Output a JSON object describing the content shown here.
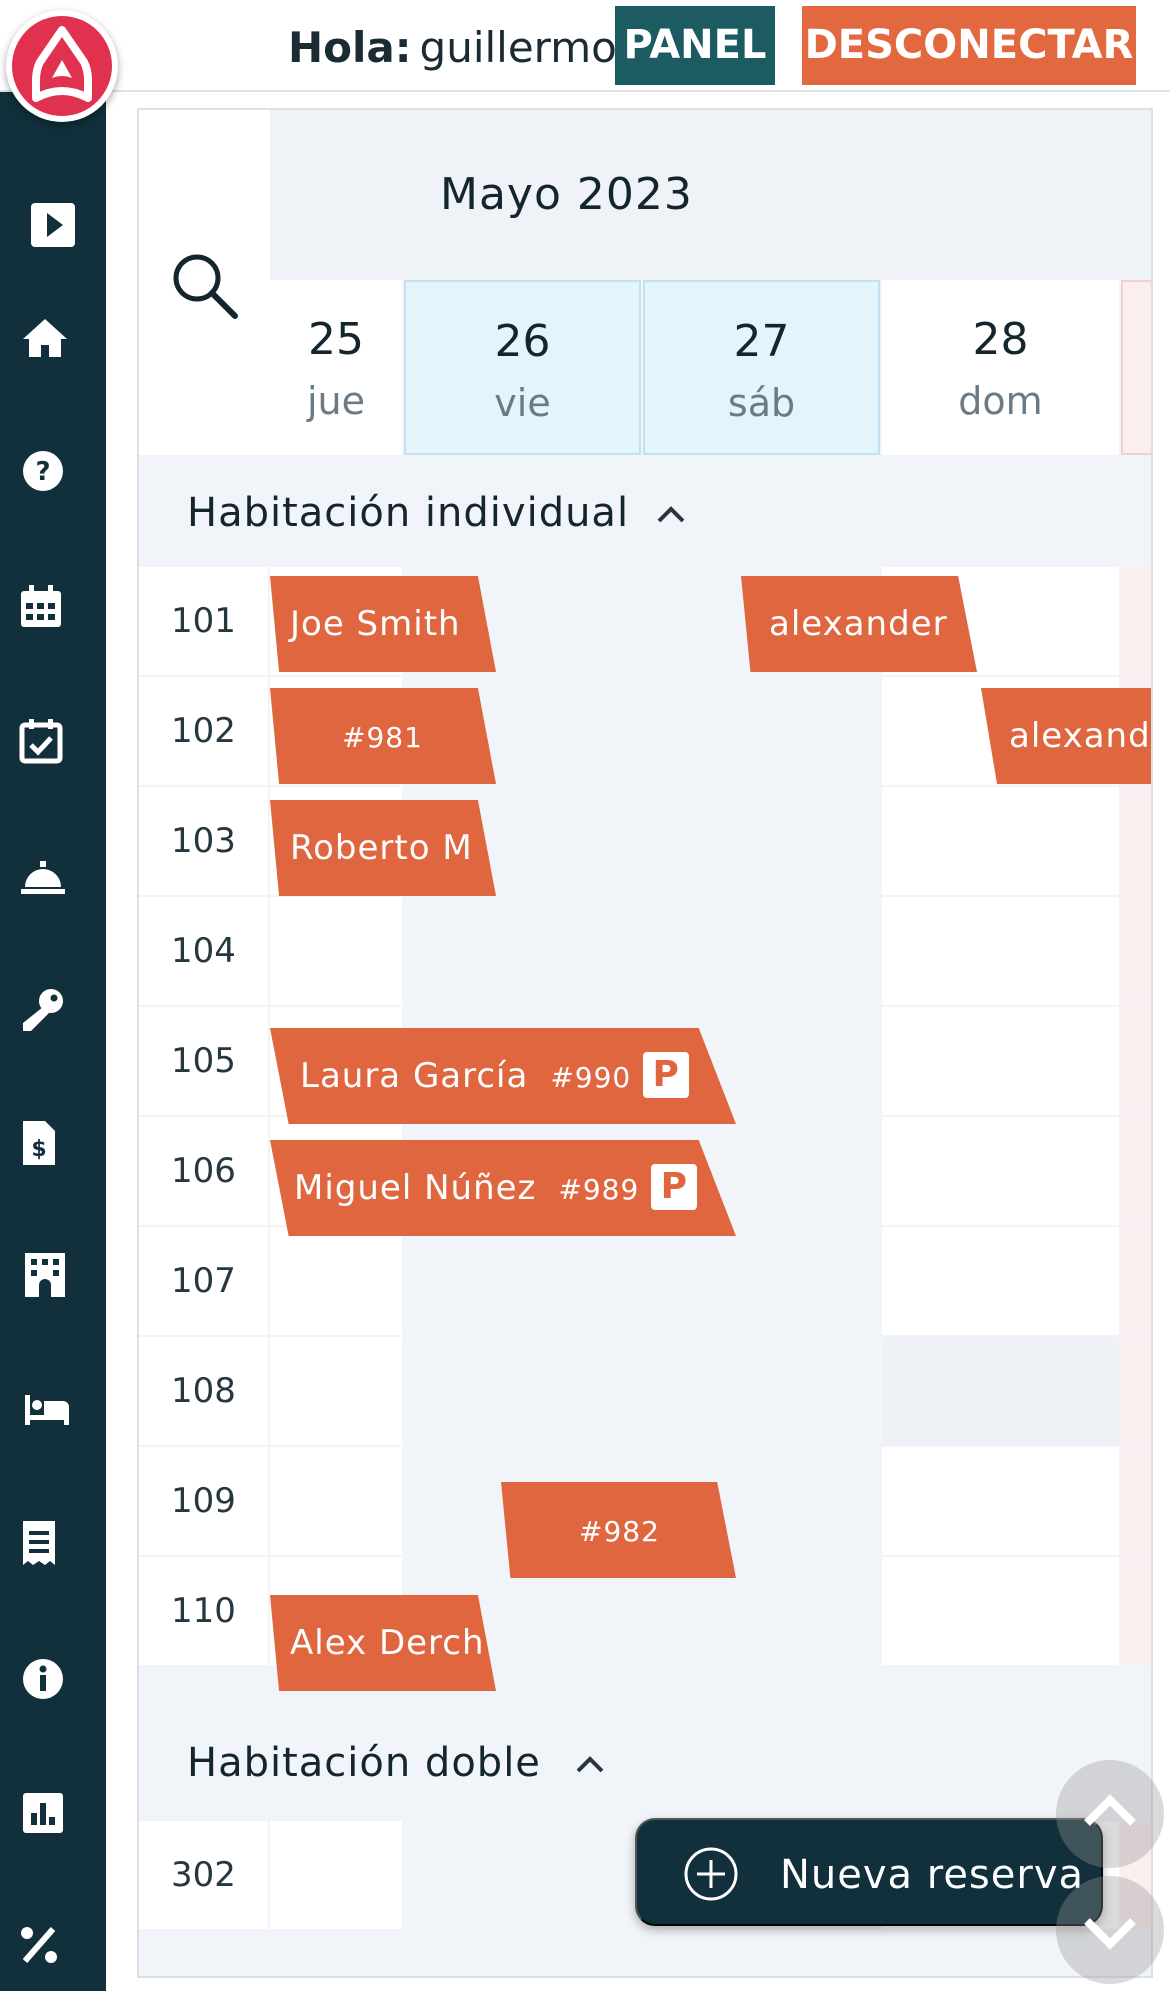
{
  "header": {
    "greeting_label": "Hola:",
    "user_name": "guillermo",
    "panel_label": "PANEL",
    "logout_label": "DESCONECTAR"
  },
  "sidebar": {
    "icons": [
      "play-icon",
      "home-icon",
      "help-icon",
      "calendar-icon",
      "calendar-check-icon",
      "concierge-bell-icon",
      "key-icon",
      "invoice-icon",
      "building-icon",
      "bed-icon",
      "receipt-icon",
      "info-icon",
      "chart-icon",
      "percent-icon"
    ]
  },
  "calendar": {
    "month_title": "Mayo 2023",
    "days": [
      {
        "num": "25",
        "weekday": "jue"
      },
      {
        "num": "26",
        "weekday": "vie"
      },
      {
        "num": "27",
        "weekday": "sáb"
      },
      {
        "num": "28",
        "weekday": "dom"
      }
    ],
    "groups": [
      {
        "label": "Habitación individual"
      },
      {
        "label": "Habitación doble"
      }
    ],
    "rooms": [
      "101",
      "102",
      "103",
      "104",
      "105",
      "106",
      "107",
      "108",
      "109",
      "110",
      "302"
    ],
    "bookings": [
      {
        "guest": "Joe Smith",
        "ref": ""
      },
      {
        "guest": "alexander",
        "ref": ""
      },
      {
        "guest": "",
        "ref": "#981"
      },
      {
        "guest": "alexander",
        "ref": ""
      },
      {
        "guest": "Roberto M",
        "ref": ""
      },
      {
        "guest": "Laura García",
        "ref": "#990",
        "badge": "P"
      },
      {
        "guest": "Miguel Núñez",
        "ref": "#989",
        "badge": "P"
      },
      {
        "guest": "",
        "ref": "#982"
      },
      {
        "guest": "Alex Derch",
        "ref": ""
      }
    ]
  },
  "new_booking_label": "Nueva reserva",
  "colors": {
    "sidebar": "#11303b",
    "accent": "#e0663f",
    "panel_button": "#1c5b62",
    "logo": "#e0314f"
  }
}
